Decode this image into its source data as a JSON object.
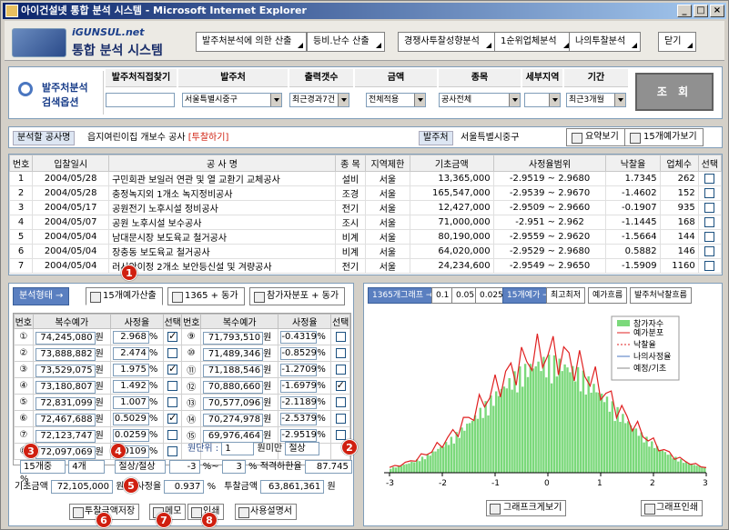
{
  "window": {
    "title": "아이건설넷 통합 분석 시스템 - Microsoft Internet Explorer",
    "min": "_",
    "max": "□",
    "close": "×"
  },
  "header": {
    "logo_sub": "iGUNSUL.net",
    "logo_main": "통합 분석 시스템",
    "buttons": [
      "발주처분석에 의한 산출",
      "등비.난수 산출",
      "경쟁사투찰성향분석",
      "1순위업체분석",
      "나의투찰분석"
    ],
    "close": "닫기"
  },
  "search": {
    "label1": "발주처분석",
    "label2": "검색옵션",
    "columns": [
      "발주처직접찾기",
      "발주처",
      "출력갯수",
      "금액",
      "종목",
      "세부지역",
      "기간"
    ],
    "values": [
      "",
      "서울특별시중구",
      "최근경과7건",
      "전체적용",
      "공사전체",
      "",
      "최근3개월"
    ],
    "submit": "조 회"
  },
  "info": {
    "k1": "분석할 공사명",
    "v1": "읍지여린이집 개보수 공사",
    "v1b": "[투찰하기]",
    "k2": "발주처",
    "v2": "서울특별시중구",
    "btn1": "요약보기",
    "btn2": "15개예가보기"
  },
  "grid": {
    "headers": [
      "번호",
      "입찰일시",
      "공 사 명",
      "종 목",
      "지역제한",
      "기초금액",
      "사정율범위",
      "낙찰율",
      "업체수",
      "선택"
    ],
    "rows": [
      [
        "1",
        "2004/05/28",
        "구민회관 보일러 연관 및 열 교환기 교체공사",
        "설비",
        "서울",
        "13,365,000",
        "-2.9519 ~ 2.9680",
        "1.7345",
        "262",
        false
      ],
      [
        "2",
        "2004/05/28",
        "충정녹지외 1개소 녹지정비공사",
        "조경",
        "서울",
        "165,547,000",
        "-2.9539 ~ 2.9670",
        "-1.4602",
        "152",
        false
      ],
      [
        "3",
        "2004/05/17",
        "공원전기 노후시설 정비공사",
        "전기",
        "서울",
        "12,427,000",
        "-2.9509 ~ 2.9660",
        "-0.1907",
        "935",
        false
      ],
      [
        "4",
        "2004/05/07",
        "공원 노후시설 보수공사",
        "조시",
        "서울",
        "71,000,000",
        "-2.951 ~ 2.962",
        "-1.1445",
        "168",
        false
      ],
      [
        "5",
        "2004/05/04",
        "남대문시장 보도육교 철거공사",
        "비계",
        "서울",
        "80,190,000",
        "-2.9559 ~ 2.9620",
        "-1.5664",
        "144",
        false
      ],
      [
        "6",
        "2004/05/04",
        "장충동 보도육교 철거공사",
        "비계",
        "서울",
        "64,020,000",
        "-2.9529 ~ 2.9680",
        "0.5882",
        "146",
        false
      ],
      [
        "7",
        "2004/05/04",
        "러시안이정 2개소 보안등신설 및 겨량공사",
        "전기",
        "서울",
        "24,234,600",
        "-2.9549 ~ 2.9650",
        "-1.5909",
        "1160",
        false
      ]
    ]
  },
  "left": {
    "tab_blue": "분석형태 →",
    "tabs": [
      "15개예가산출",
      "1365 + 동가",
      "참가자분포 + 동가"
    ],
    "col_headers": [
      "번호",
      "복수예가",
      "사정율",
      "선택"
    ],
    "rows": [
      [
        "①",
        "74,245,080",
        "2.968",
        true,
        "⑨",
        "71,793,510",
        "-0.4319",
        false
      ],
      [
        "②",
        "73,888,882",
        "2.474",
        false,
        "⑩",
        "71,489,346",
        "-0.8529",
        false
      ],
      [
        "③",
        "73,529,075",
        "1.975",
        true,
        "⑪",
        "71,188,546",
        "-1.2709",
        false
      ],
      [
        "④",
        "73,180,807",
        "1.492",
        false,
        "⑫",
        "70,880,660",
        "-1.6979",
        true
      ],
      [
        "⑤",
        "72,831,099",
        "1.007",
        false,
        "⑬",
        "70,577,096",
        "-2.1189",
        false
      ],
      [
        "⑥",
        "72,467,688",
        "0.5029",
        true,
        "⑭",
        "70,274,978",
        "-2.5379",
        false
      ],
      [
        "⑦",
        "72,123,747",
        "0.0259",
        false,
        "⑮",
        "69,976,464",
        "-2.9519",
        false
      ],
      [
        "⑧",
        "72,097,069",
        "0.0109",
        false,
        "",
        "",
        " ",
        false
      ]
    ],
    "won": "원",
    "pct": "%",
    "unit_label": "원단위 :",
    "unit_val": "1",
    "unit_suffix": "원미만",
    "unit_mode": "절상",
    "sel_a": "15개중",
    "sel_b": "4개",
    "sel_c": "절상/절상",
    "r1": "-3",
    "r2": "3",
    "pct_range_suffix": "%~",
    "tuk": "적격하한율",
    "tuk_val": "87.745",
    "base_lbl": "기초금액",
    "base_val": "72,105,000",
    "rate_lbl": "사정율",
    "rate_val": "0.937",
    "bid_lbl": "투찰금액",
    "bid_val": "63,861,361",
    "save": "투찰금액저장",
    "memo": "메모",
    "print": "인쇄",
    "manual": "사용설명서"
  },
  "right": {
    "buttons": [
      "1365개그래프 →",
      "0.1",
      "0.05",
      "0.025",
      "15개예가 →",
      "최고최저",
      "예가흐름",
      "발주처낙찰흐름"
    ],
    "legend": [
      "참가자수",
      "예가분포",
      "낙찰율",
      "나의사정율",
      "예정/기초"
    ],
    "view": "그래프크게보기",
    "print": "그래프인쇄",
    "x_ticks": [
      "-3",
      "-2",
      "-1",
      "0",
      "1",
      "2",
      "3"
    ],
    "colors": {
      "bars": "#7bd97b",
      "curve": "#e02020",
      "my": "#4a76c0"
    }
  },
  "markers": [
    "1",
    "2",
    "3",
    "4",
    "5",
    "6",
    "7",
    "8"
  ]
}
